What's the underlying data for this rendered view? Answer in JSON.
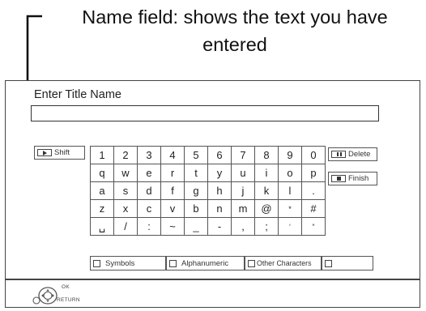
{
  "callout": {
    "text": "Name field: shows the text you have entered"
  },
  "screen": {
    "title": "Enter Title Name",
    "name_value": ""
  },
  "keyboard": {
    "rows": [
      [
        "1",
        "2",
        "3",
        "4",
        "5",
        "6",
        "7",
        "8",
        "9",
        "0"
      ],
      [
        "q",
        "w",
        "e",
        "r",
        "t",
        "y",
        "u",
        "i",
        "o",
        "p"
      ],
      [
        "a",
        "s",
        "d",
        "f",
        "g",
        "h",
        "j",
        "k",
        "l",
        "."
      ],
      [
        "z",
        "x",
        "c",
        "v",
        "b",
        "n",
        "m",
        "@",
        "*",
        "#"
      ],
      [
        "␣",
        "/",
        ":",
        "~",
        "_",
        "-",
        ",",
        ";",
        "‘",
        "“"
      ]
    ]
  },
  "side_buttons": {
    "shift": "Shift",
    "delete": "Delete",
    "finish": "Finish"
  },
  "modes": {
    "symbols": "Symbols",
    "alphanumeric": "Alphanumeric",
    "other": "Other Characters",
    "blank": ""
  },
  "footer": {
    "ok": "OK",
    "return": "RETURN"
  },
  "icons": {
    "shift_key": "play-icon",
    "delete_key": "pause-icon",
    "finish_key": "stop-icon",
    "navigator": "remote-cursor-icon"
  }
}
